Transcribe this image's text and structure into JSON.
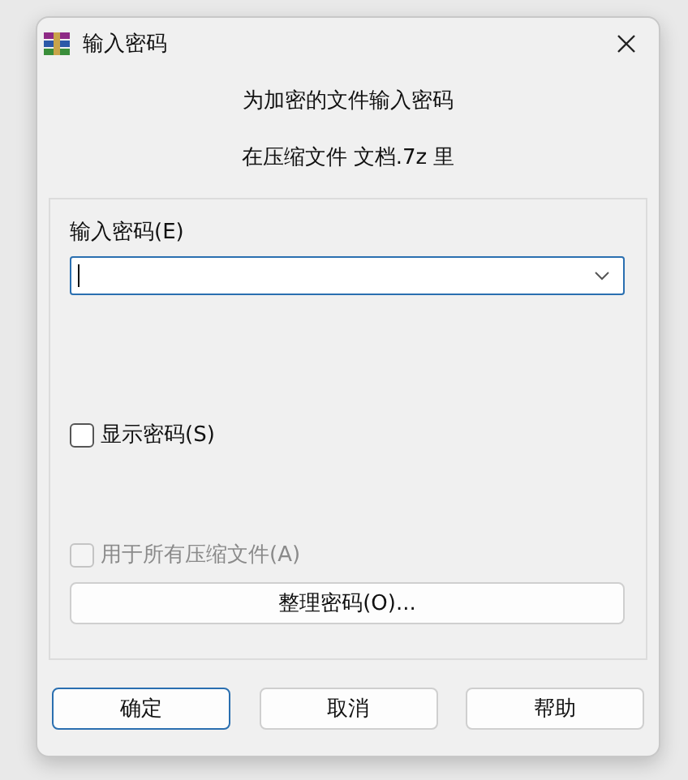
{
  "window": {
    "title": "输入密码"
  },
  "prompt": [
    "为加密的文件输入密码",
    "在压缩文件 文档.7z 里"
  ],
  "password": {
    "label": "输入密码(E)",
    "focused": true
  },
  "checkboxes": [
    {
      "label": "显示密码(S)",
      "checked": false,
      "disabled": false
    },
    {
      "label": "用于所有压缩文件(A)",
      "checked": false,
      "disabled": true
    }
  ],
  "organize_button": "整理密码(O)...",
  "buttons": [
    {
      "label": "确定",
      "default": true
    },
    {
      "label": "取消",
      "default": false
    },
    {
      "label": "帮助",
      "default": false
    }
  ]
}
